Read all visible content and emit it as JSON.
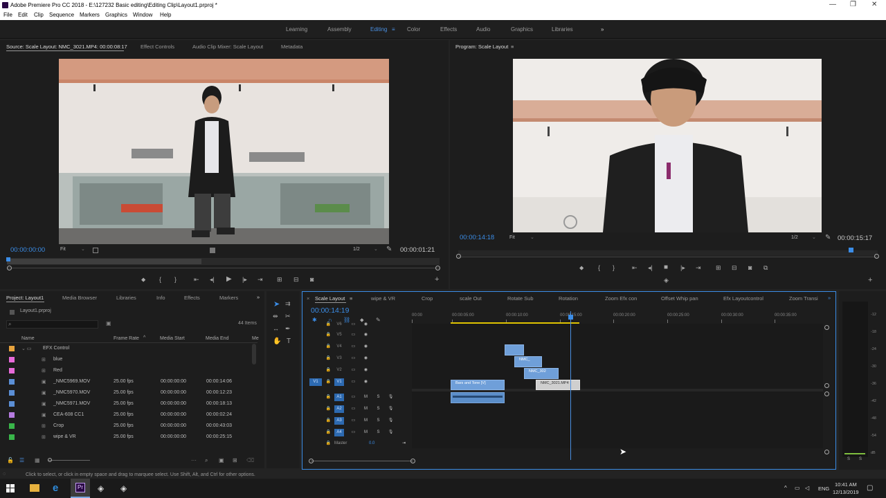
{
  "window": {
    "title": "Adobe Premiere Pro CC 2018 - E:\\127232 Basic editing\\Editing Clip\\Layout1.prproj *"
  },
  "menu": [
    "File",
    "Edit",
    "Clip",
    "Sequence",
    "Markers",
    "Graphics",
    "Window",
    "Help"
  ],
  "workspaces": {
    "items": [
      "Learning",
      "Assembly",
      "Editing",
      "Color",
      "Effects",
      "Audio",
      "Graphics",
      "Libraries"
    ],
    "active": "Editing",
    "more": "»"
  },
  "source": {
    "tabs": [
      "Source: Scale Layout: NMC_3021.MP4: 00:00:08:17",
      "Effect Controls",
      "Audio Clip Mixer: Scale Layout",
      "Metadata"
    ],
    "timecode_in": "00:00:00:00",
    "fit": "Fit",
    "resolution": "1/2",
    "duration": "00:00:01:21"
  },
  "program": {
    "tab": "Program: Scale Layout",
    "timecode": "00:00:14:18",
    "fit": "Fit",
    "resolution": "1/2",
    "duration": "00:00:15:17"
  },
  "project": {
    "tabs": [
      "Project: Layout1",
      "Media Browser",
      "Libraries",
      "Info",
      "Effects",
      "Markers"
    ],
    "file": "Layout1.prproj",
    "count": "44 Items",
    "columns": [
      "Name",
      "Frame Rate",
      "Media Start",
      "Media End",
      "Me"
    ],
    "rows": [
      {
        "name": "EFX Control",
        "rate": "",
        "start": "",
        "end": "",
        "color": "#e8a33d",
        "kind": "folder"
      },
      {
        "name": "blue",
        "rate": "",
        "start": "",
        "end": "",
        "color": "#e76ad9",
        "kind": "seq"
      },
      {
        "name": "Red",
        "rate": "",
        "start": "",
        "end": "",
        "color": "#e76ad9",
        "kind": "seq"
      },
      {
        "name": "_NMC5969.MOV",
        "rate": "25.00 fps",
        "start": "00:00:00:00",
        "end": "00:00:14:06",
        "color": "#5b8fd6",
        "kind": "clip"
      },
      {
        "name": "_NMC5970.MOV",
        "rate": "25.00 fps",
        "start": "00:00:00:00",
        "end": "00:00:12:23",
        "color": "#5b8fd6",
        "kind": "clip"
      },
      {
        "name": "_NMC5971.MOV",
        "rate": "25.00 fps",
        "start": "00:00:00:00",
        "end": "00:00:18:13",
        "color": "#5b8fd6",
        "kind": "clip"
      },
      {
        "name": "CEA-608 CC1",
        "rate": "25.00 fps",
        "start": "00:00:00:00",
        "end": "00:00:02:24",
        "color": "#b57be0",
        "kind": "cc"
      },
      {
        "name": "Crop",
        "rate": "25.00 fps",
        "start": "00:00:00:00",
        "end": "00:00:43:03",
        "color": "#39b54a",
        "kind": "seq"
      },
      {
        "name": "wipe & VR",
        "rate": "25.00 fps",
        "start": "00:00:00:00",
        "end": "00:00:25:15",
        "color": "#39b54a",
        "kind": "seq"
      }
    ]
  },
  "timeline": {
    "tabs": [
      "Scale Layout",
      "wipe & VR",
      "Crop",
      "scale Out",
      "Rotate Sub",
      "Rotation",
      "Zoom Efx con",
      "Offset Whip pan",
      "Efx Layoutcontrol",
      "Zoom Transi"
    ],
    "timecode": "00:00:14:19",
    "ruler": [
      "00:00",
      "00:00:05:00",
      "00:00:10:00",
      "00:00:15:00",
      "00:00:20:00",
      "00:00:25:00",
      "00:00:30:00",
      "00:00:35:00"
    ],
    "video_tracks": [
      "V6",
      "V5",
      "V4",
      "V3",
      "V2",
      "V1"
    ],
    "audio_tracks": [
      "A1",
      "A2",
      "A3",
      "A4"
    ],
    "master": "Master",
    "master_val": "0.0",
    "clips": [
      {
        "label": "",
        "track": "V4"
      },
      {
        "label": "NMC_",
        "track": "V3"
      },
      {
        "label": "NMC_302",
        "track": "V2"
      },
      {
        "label": "Bars and Tone [V]",
        "track": "V1"
      },
      {
        "label": "NMC_3021.MP4",
        "track": "V1"
      }
    ],
    "meter_labels": [
      "-12",
      "-18",
      "-24",
      "-30",
      "-36",
      "-42",
      "-48",
      "-54",
      "dB"
    ],
    "meter_s": [
      "S",
      "S"
    ]
  },
  "status": "Click to select, or click in empty space and drag to marquee select. Use Shift, Alt, and Ctrl for other options.",
  "taskbar": {
    "lang": "ENG",
    "time": "10:41 AM",
    "date": "12/13/2019"
  }
}
